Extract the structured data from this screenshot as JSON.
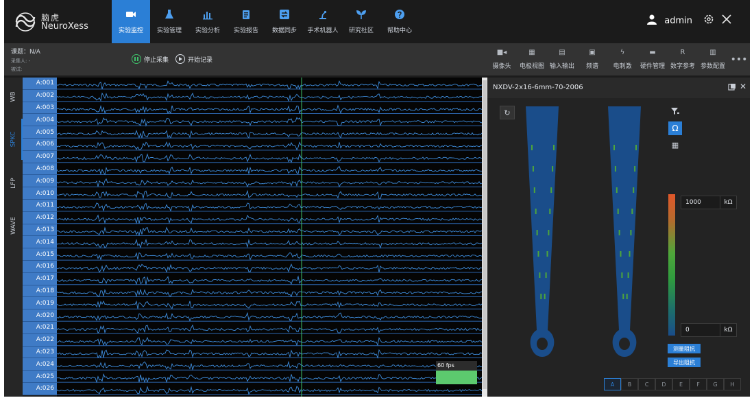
{
  "brand": {
    "name_cn": "脑虎",
    "name_en": "NeuroXess",
    "color": "#2b7fd6"
  },
  "nav": [
    {
      "label": "实验监控",
      "icon": "video-camera-icon",
      "active": true
    },
    {
      "label": "实验管理",
      "icon": "flask-icon"
    },
    {
      "label": "实验分析",
      "icon": "bar-chart-icon"
    },
    {
      "label": "实验报告",
      "icon": "clipboard-icon"
    },
    {
      "label": "数据同步",
      "icon": "sync-arrows-icon"
    },
    {
      "label": "手术机器人",
      "icon": "robot-arm-icon"
    },
    {
      "label": "研究社区",
      "icon": "sprout-icon"
    },
    {
      "label": "帮助中心",
      "icon": "help-circle-icon"
    }
  ],
  "user": {
    "name": "admin"
  },
  "project": {
    "title": "课题：N/A",
    "collector": "采集人: -",
    "subject": "被试:"
  },
  "acquisition": {
    "stop_label": "停止采集",
    "record_label": "开始记录"
  },
  "tools": [
    {
      "label": "摄像头",
      "icon": "■◂"
    },
    {
      "label": "电极视图",
      "icon": "▦"
    },
    {
      "label": "输入输出",
      "icon": "▤"
    },
    {
      "label": "频谱",
      "icon": "▣"
    },
    {
      "label": "电刺激",
      "icon": "ϟ"
    },
    {
      "label": "硬件管理",
      "icon": "▬"
    },
    {
      "label": "数字参考",
      "icon": "R"
    },
    {
      "label": "参数配置",
      "icon": "▥"
    }
  ],
  "more_label": "•••",
  "vtabs": [
    {
      "label": "WB"
    },
    {
      "label": "SPKC",
      "active": true
    },
    {
      "label": "LFP"
    },
    {
      "label": "WAVE"
    }
  ],
  "channels": [
    "A:001",
    "A:002",
    "A:003",
    "A:004",
    "A:005",
    "A:006",
    "A:007",
    "A:008",
    "A:009",
    "A:010",
    "A:011",
    "A:012",
    "A:013",
    "A:014",
    "A:015",
    "A:016",
    "A:017",
    "A:018",
    "A:019",
    "A:020",
    "A:021",
    "A:022",
    "A:023",
    "A:024",
    "A:025",
    "A:026"
  ],
  "fps": {
    "label": "60 fps"
  },
  "panel": {
    "title": "NXDV-2x16-6mm-70-2006",
    "refresh_icon": "↻",
    "close_icon": "✕",
    "ohm_icon": "Ω",
    "filter_icon": "filter-icon",
    "grid_icon": "▦",
    "max_value": "1000",
    "min_value": "0",
    "unit": "kΩ",
    "measure_label": "测量阻抗",
    "export_label": "导出阻抗",
    "shank_tabs": [
      "A",
      "B",
      "C",
      "D",
      "E",
      "F",
      "G",
      "H"
    ],
    "active_shank": "A",
    "probe_color": "#1a4d8a",
    "contact_color": "#4ea63a"
  }
}
